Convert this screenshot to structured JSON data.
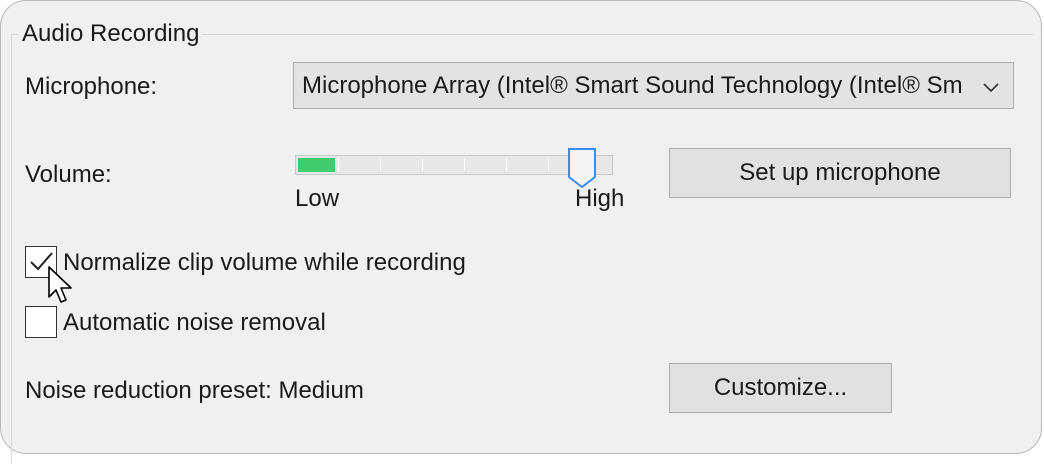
{
  "group": {
    "title": "Audio Recording"
  },
  "microphone": {
    "label": "Microphone:",
    "selected": "Microphone Array (Intel® Smart Sound Technology (Intel® Smart Sound Technology for Digital Microphones))"
  },
  "volume": {
    "label": "Volume:",
    "low_label": "Low",
    "high_label": "High",
    "input_level": 0.12,
    "slider_value": 0.95,
    "level_color": "#3fcb6e"
  },
  "buttons": {
    "setup_microphone": "Set up microphone",
    "customize": "Customize..."
  },
  "options": {
    "normalize": {
      "label": "Normalize clip volume while recording",
      "checked": true
    },
    "noise_removal": {
      "label": "Automatic noise removal",
      "checked": false
    }
  },
  "noise_preset": {
    "text": "Noise reduction preset: Medium"
  }
}
